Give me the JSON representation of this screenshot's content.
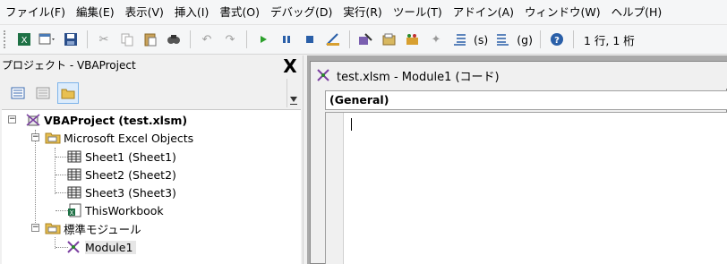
{
  "menu": [
    {
      "label": "ファイル(F)"
    },
    {
      "label": "編集(E)"
    },
    {
      "label": "表示(V)"
    },
    {
      "label": "挿入(I)"
    },
    {
      "label": "書式(O)"
    },
    {
      "label": "デバッグ(D)"
    },
    {
      "label": "実行(R)"
    },
    {
      "label": "ツール(T)"
    },
    {
      "label": "アドイン(A)"
    },
    {
      "label": "ウィンドウ(W)"
    },
    {
      "label": "ヘルプ(H)"
    }
  ],
  "toolbar": {
    "bookmark_s": "(s)",
    "bookmark_g": "(g)",
    "position": "1 行, 1 桁"
  },
  "project": {
    "title": "プロジェクト - VBAProject",
    "close": "X",
    "root": "VBAProject (test.xlsm)",
    "excel_objects": "Microsoft Excel Objects",
    "sheets": [
      "Sheet1 (Sheet1)",
      "Sheet2 (Sheet2)",
      "Sheet3 (Sheet3)"
    ],
    "workbook": "ThisWorkbook",
    "modules_folder": "標準モジュール",
    "module": "Module1"
  },
  "code_window": {
    "title": "test.xlsm - Module1 (コード)",
    "object_combo": "(General)"
  }
}
